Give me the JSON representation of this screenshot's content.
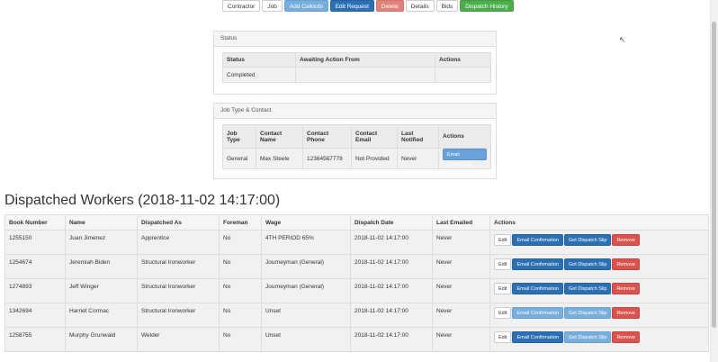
{
  "tabs": [
    {
      "label": "Contractor",
      "style": "default"
    },
    {
      "label": "Job",
      "style": "default"
    },
    {
      "label": "Add Callouts",
      "style": "light-blue"
    },
    {
      "label": "Edit Request",
      "style": "blue"
    },
    {
      "label": "Delete",
      "style": "red"
    },
    {
      "label": "Details",
      "style": "default"
    },
    {
      "label": "Bids",
      "style": "default"
    },
    {
      "label": "Dispatch History",
      "style": "green"
    }
  ],
  "status_panel": {
    "heading": "Status",
    "columns": [
      "Status",
      "Awaiting Action From",
      "Actions"
    ],
    "row": [
      "Completed",
      "",
      ""
    ]
  },
  "job_panel": {
    "heading": "Job Type & Contact",
    "columns": [
      "Job Type",
      "Contact Name",
      "Contact Phone",
      "Contact Email",
      "Last Notified",
      "Actions"
    ],
    "row": [
      "General",
      "Max Steele",
      "12364567778",
      "Not Provided",
      "Never"
    ],
    "email_button": "Email Notification"
  },
  "dispatched": {
    "title": "Dispatched Workers (2018-11-02 14:17:00)",
    "columns": [
      "Book Number",
      "Name",
      "Dispatched As",
      "Foreman",
      "Wage",
      "Dispatch Date",
      "Last Emailed",
      "Actions"
    ],
    "rows": [
      {
        "book": "1255150",
        "name": "Juan Jimenez",
        "as": "Apprentice",
        "foreman": "No",
        "wage": "4TH PERIOD 65%",
        "date": "2018-11-02 14:17:00",
        "emailed": "Never",
        "conf_light": false,
        "slip_light": false
      },
      {
        "book": "1254674",
        "name": "Jeremiah Biden",
        "as": "Structural Ironworker",
        "foreman": "No",
        "wage": "Journeyman (General)",
        "date": "2018-11-02 14:17:00",
        "emailed": "Never",
        "conf_light": false,
        "slip_light": false
      },
      {
        "book": "1274893",
        "name": "Jeff Winger",
        "as": "Structural Ironworker",
        "foreman": "No",
        "wage": "Journeyman (General)",
        "date": "2018-11-02 14:17:00",
        "emailed": "Never",
        "conf_light": false,
        "slip_light": false
      },
      {
        "book": "1342694",
        "name": "Harriet Cormac",
        "as": "Structural Ironworker",
        "foreman": "No",
        "wage": "Unset",
        "date": "2018-11-02 14:17:00",
        "emailed": "Never",
        "conf_light": true,
        "slip_light": true
      },
      {
        "book": "1258755",
        "name": "Murphy Grunwald",
        "as": "Welder",
        "foreman": "No",
        "wage": "Unset",
        "date": "2018-11-02 14:17:00",
        "emailed": "Never",
        "conf_light": false,
        "slip_light": true
      }
    ],
    "actions": {
      "edit": "Edit",
      "confirm": "Email Confirmation",
      "slip": "Get Dispatch Slip",
      "remove": "Remove"
    }
  },
  "colors": {
    "primary": "#2c70b3",
    "info_light": "#77aedb",
    "danger": "#d9534f",
    "success": "#4cae4c"
  },
  "cursor_icon": "arrow-cursor-icon"
}
